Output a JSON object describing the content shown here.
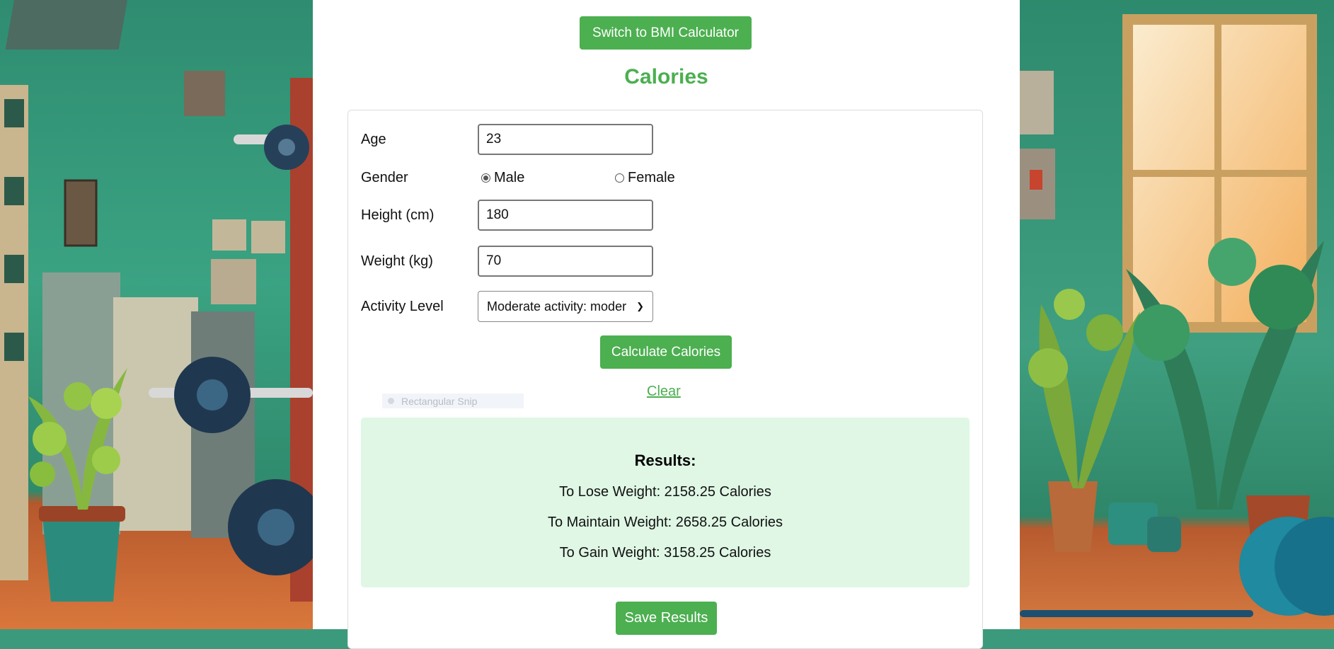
{
  "toggle": {
    "label": "Switch to BMI Calculator"
  },
  "page": {
    "title": "Calories"
  },
  "form": {
    "age": {
      "label": "Age",
      "value": "23"
    },
    "gender": {
      "label": "Gender",
      "options": [
        "Male",
        "Female"
      ],
      "selected": "Male"
    },
    "height": {
      "label": "Height (cm)",
      "value": "180"
    },
    "weight": {
      "label": "Weight (kg)",
      "value": "70"
    },
    "activity": {
      "label": "Activity Level",
      "selected": "Moderate activity: moder"
    },
    "calculate_label": "Calculate Calories",
    "clear_label": "Clear"
  },
  "overlay": {
    "snip_label": "Rectangular Snip"
  },
  "results": {
    "title": "Results:",
    "lose": "To Lose Weight: 2158.25 Calories",
    "maintain": "To Maintain Weight: 2658.25 Calories",
    "gain": "To Gain Weight: 3158.25 Calories"
  },
  "save_label": "Save Results",
  "colors": {
    "accent": "#4caf50",
    "results_bg": "#dff7e4",
    "scene_wall": "#3aa382",
    "scene_floor": "#d9773c"
  }
}
